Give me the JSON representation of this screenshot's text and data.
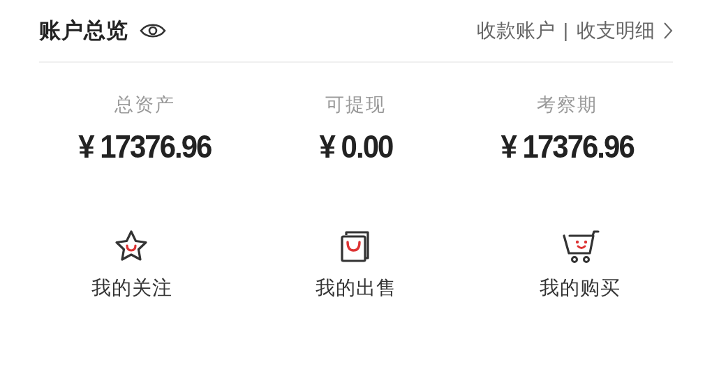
{
  "header": {
    "title": "账户总览",
    "links": [
      "收款账户",
      "收支明细"
    ],
    "separator": "|"
  },
  "stats": [
    {
      "label": "总资产",
      "amount": "¥ 17376.96"
    },
    {
      "label": "可提现",
      "amount": "¥ 0.00"
    },
    {
      "label": "考察期",
      "amount": "¥ 17376.96"
    }
  ],
  "shortcuts": [
    {
      "kind": "star",
      "label": "我的关注"
    },
    {
      "kind": "bag",
      "label": "我的出售"
    },
    {
      "kind": "cart",
      "label": "我的购买"
    }
  ]
}
